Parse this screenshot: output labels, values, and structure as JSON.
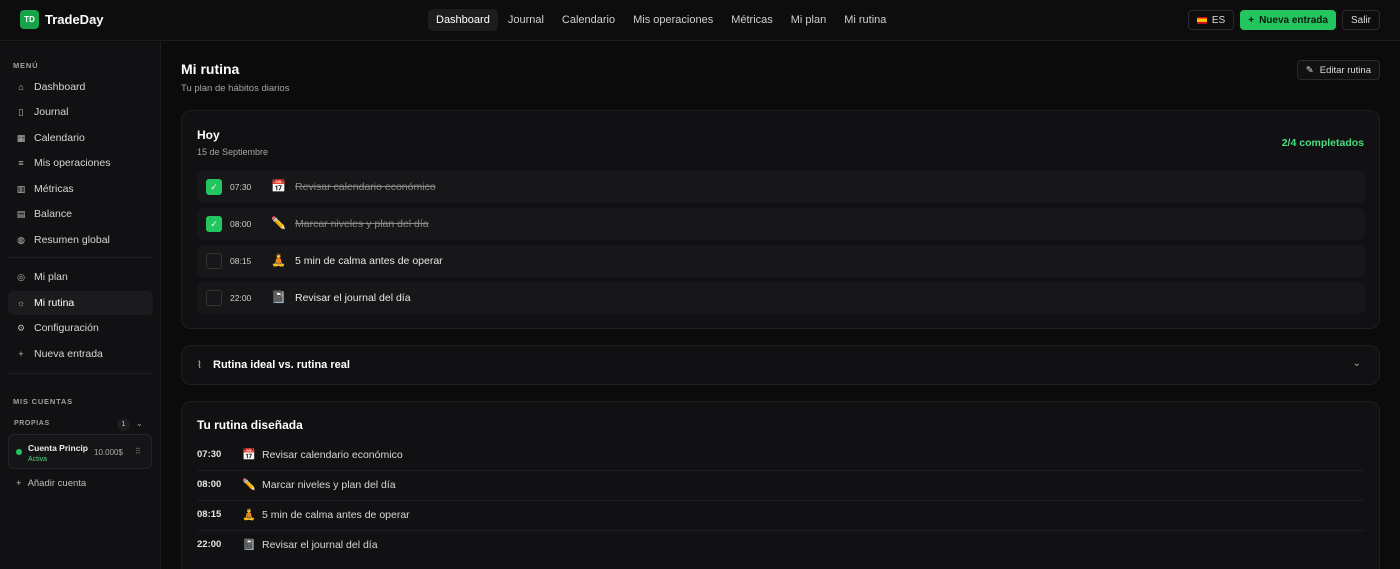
{
  "app": {
    "logo_abbr": "TD",
    "name": "TradeDay"
  },
  "nav": [
    "Dashboard",
    "Journal",
    "Calendario",
    "Mis operaciones",
    "Métricas",
    "Mi plan",
    "Mi rutina"
  ],
  "topbar": {
    "lang": "ES",
    "new_entry": "Nueva entrada",
    "logout": "Salir"
  },
  "sidebar": {
    "menu_title": "MENÚ",
    "items": [
      {
        "label": "Dashboard",
        "icon": "home-icon"
      },
      {
        "label": "Journal",
        "icon": "book-icon"
      },
      {
        "label": "Calendario",
        "icon": "calendar-icon"
      },
      {
        "label": "Mis operaciones",
        "icon": "list-icon"
      },
      {
        "label": "Métricas",
        "icon": "chart-icon"
      },
      {
        "label": "Balance",
        "icon": "document-icon"
      },
      {
        "label": "Resumen global",
        "icon": "globe-icon"
      }
    ],
    "items2": [
      {
        "label": "Mi plan",
        "icon": "target-icon"
      },
      {
        "label": "Mi rutina",
        "icon": "sun-icon"
      },
      {
        "label": "Configuración",
        "icon": "gear-icon"
      },
      {
        "label": "Nueva entrada",
        "icon": "plus-icon"
      }
    ],
    "accounts_title": "MIS CUENTAS",
    "propias": "PROPIAS",
    "propias_count": "1",
    "account": {
      "name": "Cuenta Principal",
      "status": "Activa",
      "balance": "10.000$"
    },
    "add_account": "Añadir cuenta"
  },
  "page": {
    "title": "Mi rutina",
    "subtitle": "Tu plan de hábitos diarios",
    "edit": "Editar rutina"
  },
  "today": {
    "title": "Hoy",
    "date": "15 de Septiembre",
    "completed": "2/4 completados",
    "tasks": [
      {
        "time": "07:30",
        "emoji": "📅",
        "label": "Revisar calendario económico",
        "done": true
      },
      {
        "time": "08:00",
        "emoji": "✏️",
        "label": "Marcar niveles y plan del día",
        "done": true
      },
      {
        "time": "08:15",
        "emoji": "🧘",
        "label": "5 min de calma antes de operar",
        "done": false
      },
      {
        "time": "22:00",
        "emoji": "📓",
        "label": "Revisar el journal del día",
        "done": false
      }
    ]
  },
  "compare": {
    "title": "Rutina ideal vs. rutina real"
  },
  "designed": {
    "title": "Tu rutina diseñada",
    "rows": [
      {
        "time": "07:30",
        "emoji": "📅",
        "label": "Revisar calendario económico"
      },
      {
        "time": "08:00",
        "emoji": "✏️",
        "label": "Marcar niveles y plan del día"
      },
      {
        "time": "08:15",
        "emoji": "🧘",
        "label": "5 min de calma antes de operar"
      },
      {
        "time": "22:00",
        "emoji": "📓",
        "label": "Revisar el journal del día"
      }
    ]
  }
}
